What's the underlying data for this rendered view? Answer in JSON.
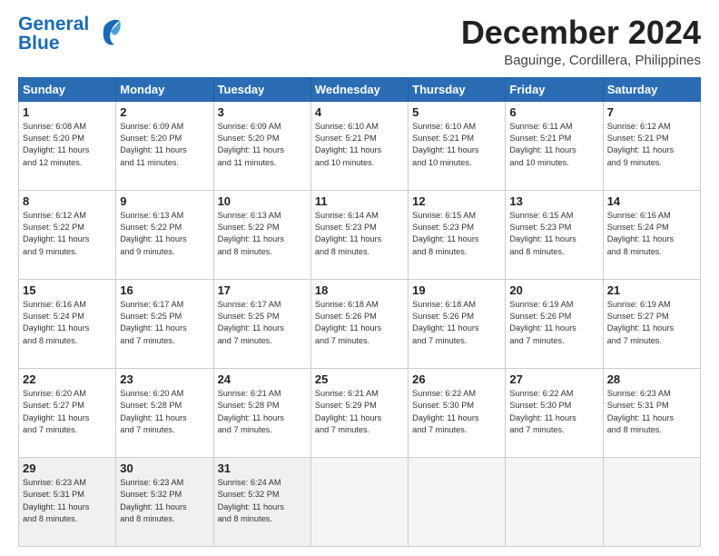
{
  "logo": {
    "line1": "General",
    "line2": "Blue"
  },
  "title": "December 2024",
  "subtitle": "Baguinge, Cordillera, Philippines",
  "days_header": [
    "Sunday",
    "Monday",
    "Tuesday",
    "Wednesday",
    "Thursday",
    "Friday",
    "Saturday"
  ],
  "weeks": [
    [
      {
        "day": "1",
        "info": "Sunrise: 6:08 AM\nSunset: 5:20 PM\nDaylight: 11 hours\nand 12 minutes."
      },
      {
        "day": "2",
        "info": "Sunrise: 6:09 AM\nSunset: 5:20 PM\nDaylight: 11 hours\nand 11 minutes."
      },
      {
        "day": "3",
        "info": "Sunrise: 6:09 AM\nSunset: 5:20 PM\nDaylight: 11 hours\nand 11 minutes."
      },
      {
        "day": "4",
        "info": "Sunrise: 6:10 AM\nSunset: 5:21 PM\nDaylight: 11 hours\nand 10 minutes."
      },
      {
        "day": "5",
        "info": "Sunrise: 6:10 AM\nSunset: 5:21 PM\nDaylight: 11 hours\nand 10 minutes."
      },
      {
        "day": "6",
        "info": "Sunrise: 6:11 AM\nSunset: 5:21 PM\nDaylight: 11 hours\nand 10 minutes."
      },
      {
        "day": "7",
        "info": "Sunrise: 6:12 AM\nSunset: 5:21 PM\nDaylight: 11 hours\nand 9 minutes."
      }
    ],
    [
      {
        "day": "8",
        "info": "Sunrise: 6:12 AM\nSunset: 5:22 PM\nDaylight: 11 hours\nand 9 minutes."
      },
      {
        "day": "9",
        "info": "Sunrise: 6:13 AM\nSunset: 5:22 PM\nDaylight: 11 hours\nand 9 minutes."
      },
      {
        "day": "10",
        "info": "Sunrise: 6:13 AM\nSunset: 5:22 PM\nDaylight: 11 hours\nand 8 minutes."
      },
      {
        "day": "11",
        "info": "Sunrise: 6:14 AM\nSunset: 5:23 PM\nDaylight: 11 hours\nand 8 minutes."
      },
      {
        "day": "12",
        "info": "Sunrise: 6:15 AM\nSunset: 5:23 PM\nDaylight: 11 hours\nand 8 minutes."
      },
      {
        "day": "13",
        "info": "Sunrise: 6:15 AM\nSunset: 5:23 PM\nDaylight: 11 hours\nand 8 minutes."
      },
      {
        "day": "14",
        "info": "Sunrise: 6:16 AM\nSunset: 5:24 PM\nDaylight: 11 hours\nand 8 minutes."
      }
    ],
    [
      {
        "day": "15",
        "info": "Sunrise: 6:16 AM\nSunset: 5:24 PM\nDaylight: 11 hours\nand 8 minutes."
      },
      {
        "day": "16",
        "info": "Sunrise: 6:17 AM\nSunset: 5:25 PM\nDaylight: 11 hours\nand 7 minutes."
      },
      {
        "day": "17",
        "info": "Sunrise: 6:17 AM\nSunset: 5:25 PM\nDaylight: 11 hours\nand 7 minutes."
      },
      {
        "day": "18",
        "info": "Sunrise: 6:18 AM\nSunset: 5:26 PM\nDaylight: 11 hours\nand 7 minutes."
      },
      {
        "day": "19",
        "info": "Sunrise: 6:18 AM\nSunset: 5:26 PM\nDaylight: 11 hours\nand 7 minutes."
      },
      {
        "day": "20",
        "info": "Sunrise: 6:19 AM\nSunset: 5:26 PM\nDaylight: 11 hours\nand 7 minutes."
      },
      {
        "day": "21",
        "info": "Sunrise: 6:19 AM\nSunset: 5:27 PM\nDaylight: 11 hours\nand 7 minutes."
      }
    ],
    [
      {
        "day": "22",
        "info": "Sunrise: 6:20 AM\nSunset: 5:27 PM\nDaylight: 11 hours\nand 7 minutes."
      },
      {
        "day": "23",
        "info": "Sunrise: 6:20 AM\nSunset: 5:28 PM\nDaylight: 11 hours\nand 7 minutes."
      },
      {
        "day": "24",
        "info": "Sunrise: 6:21 AM\nSunset: 5:28 PM\nDaylight: 11 hours\nand 7 minutes."
      },
      {
        "day": "25",
        "info": "Sunrise: 6:21 AM\nSunset: 5:29 PM\nDaylight: 11 hours\nand 7 minutes."
      },
      {
        "day": "26",
        "info": "Sunrise: 6:22 AM\nSunset: 5:30 PM\nDaylight: 11 hours\nand 7 minutes."
      },
      {
        "day": "27",
        "info": "Sunrise: 6:22 AM\nSunset: 5:30 PM\nDaylight: 11 hours\nand 7 minutes."
      },
      {
        "day": "28",
        "info": "Sunrise: 6:23 AM\nSunset: 5:31 PM\nDaylight: 11 hours\nand 8 minutes."
      }
    ],
    [
      {
        "day": "29",
        "info": "Sunrise: 6:23 AM\nSunset: 5:31 PM\nDaylight: 11 hours\nand 8 minutes."
      },
      {
        "day": "30",
        "info": "Sunrise: 6:23 AM\nSunset: 5:32 PM\nDaylight: 11 hours\nand 8 minutes."
      },
      {
        "day": "31",
        "info": "Sunrise: 6:24 AM\nSunset: 5:32 PM\nDaylight: 11 hours\nand 8 minutes."
      },
      {
        "day": "",
        "info": ""
      },
      {
        "day": "",
        "info": ""
      },
      {
        "day": "",
        "info": ""
      },
      {
        "day": "",
        "info": ""
      }
    ]
  ]
}
